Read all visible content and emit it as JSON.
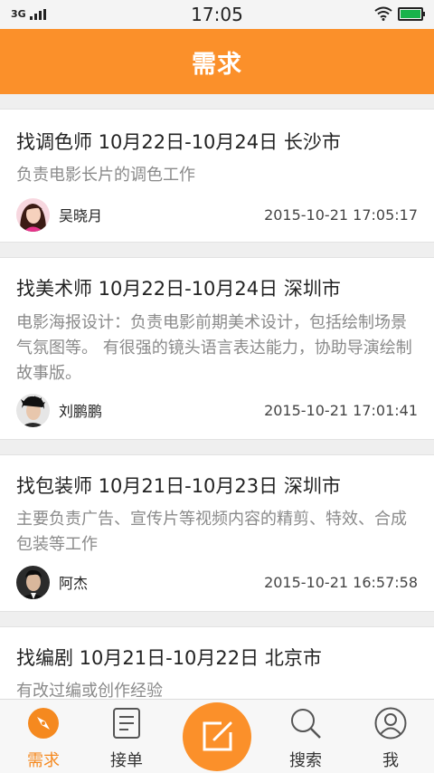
{
  "status_bar": {
    "network": "3G",
    "time": "17:05"
  },
  "header": {
    "title": "需求"
  },
  "posts": [
    {
      "title": "找调色师 10月22日-10月24日 长沙市",
      "description": "负责电影长片的调色工作",
      "author": "吴晓月",
      "time": "2015-10-21 17:05:17"
    },
    {
      "title": "找美术师 10月22日-10月24日 深圳市",
      "description": "电影海报设计：负责电影前期美术设计，包括绘制场景气氛图等。 有很强的镜头语言表达能力，协助导演绘制故事版。",
      "author": "刘鹏鹏",
      "time": "2015-10-21 17:01:41"
    },
    {
      "title": "找包装师 10月21日-10月23日 深圳市",
      "description": "主要负责广告、宣传片等视频内容的精剪、特效、合成包装等工作",
      "author": "阿杰",
      "time": "2015-10-21 16:57:58"
    },
    {
      "title": "找编剧 10月21日-10月22日 北京市",
      "description": "有改过编或创作经验"
    }
  ],
  "tabs": [
    {
      "label": "需求",
      "icon": "compass-icon",
      "active": true
    },
    {
      "label": "接单",
      "icon": "document-icon",
      "active": false
    },
    {
      "label": "搜索",
      "icon": "search-icon",
      "active": false
    },
    {
      "label": "我",
      "icon": "user-icon",
      "active": false
    }
  ],
  "colors": {
    "accent": "#fb902a",
    "active_tab": "#f5891f",
    "battery": "#18b34b"
  }
}
